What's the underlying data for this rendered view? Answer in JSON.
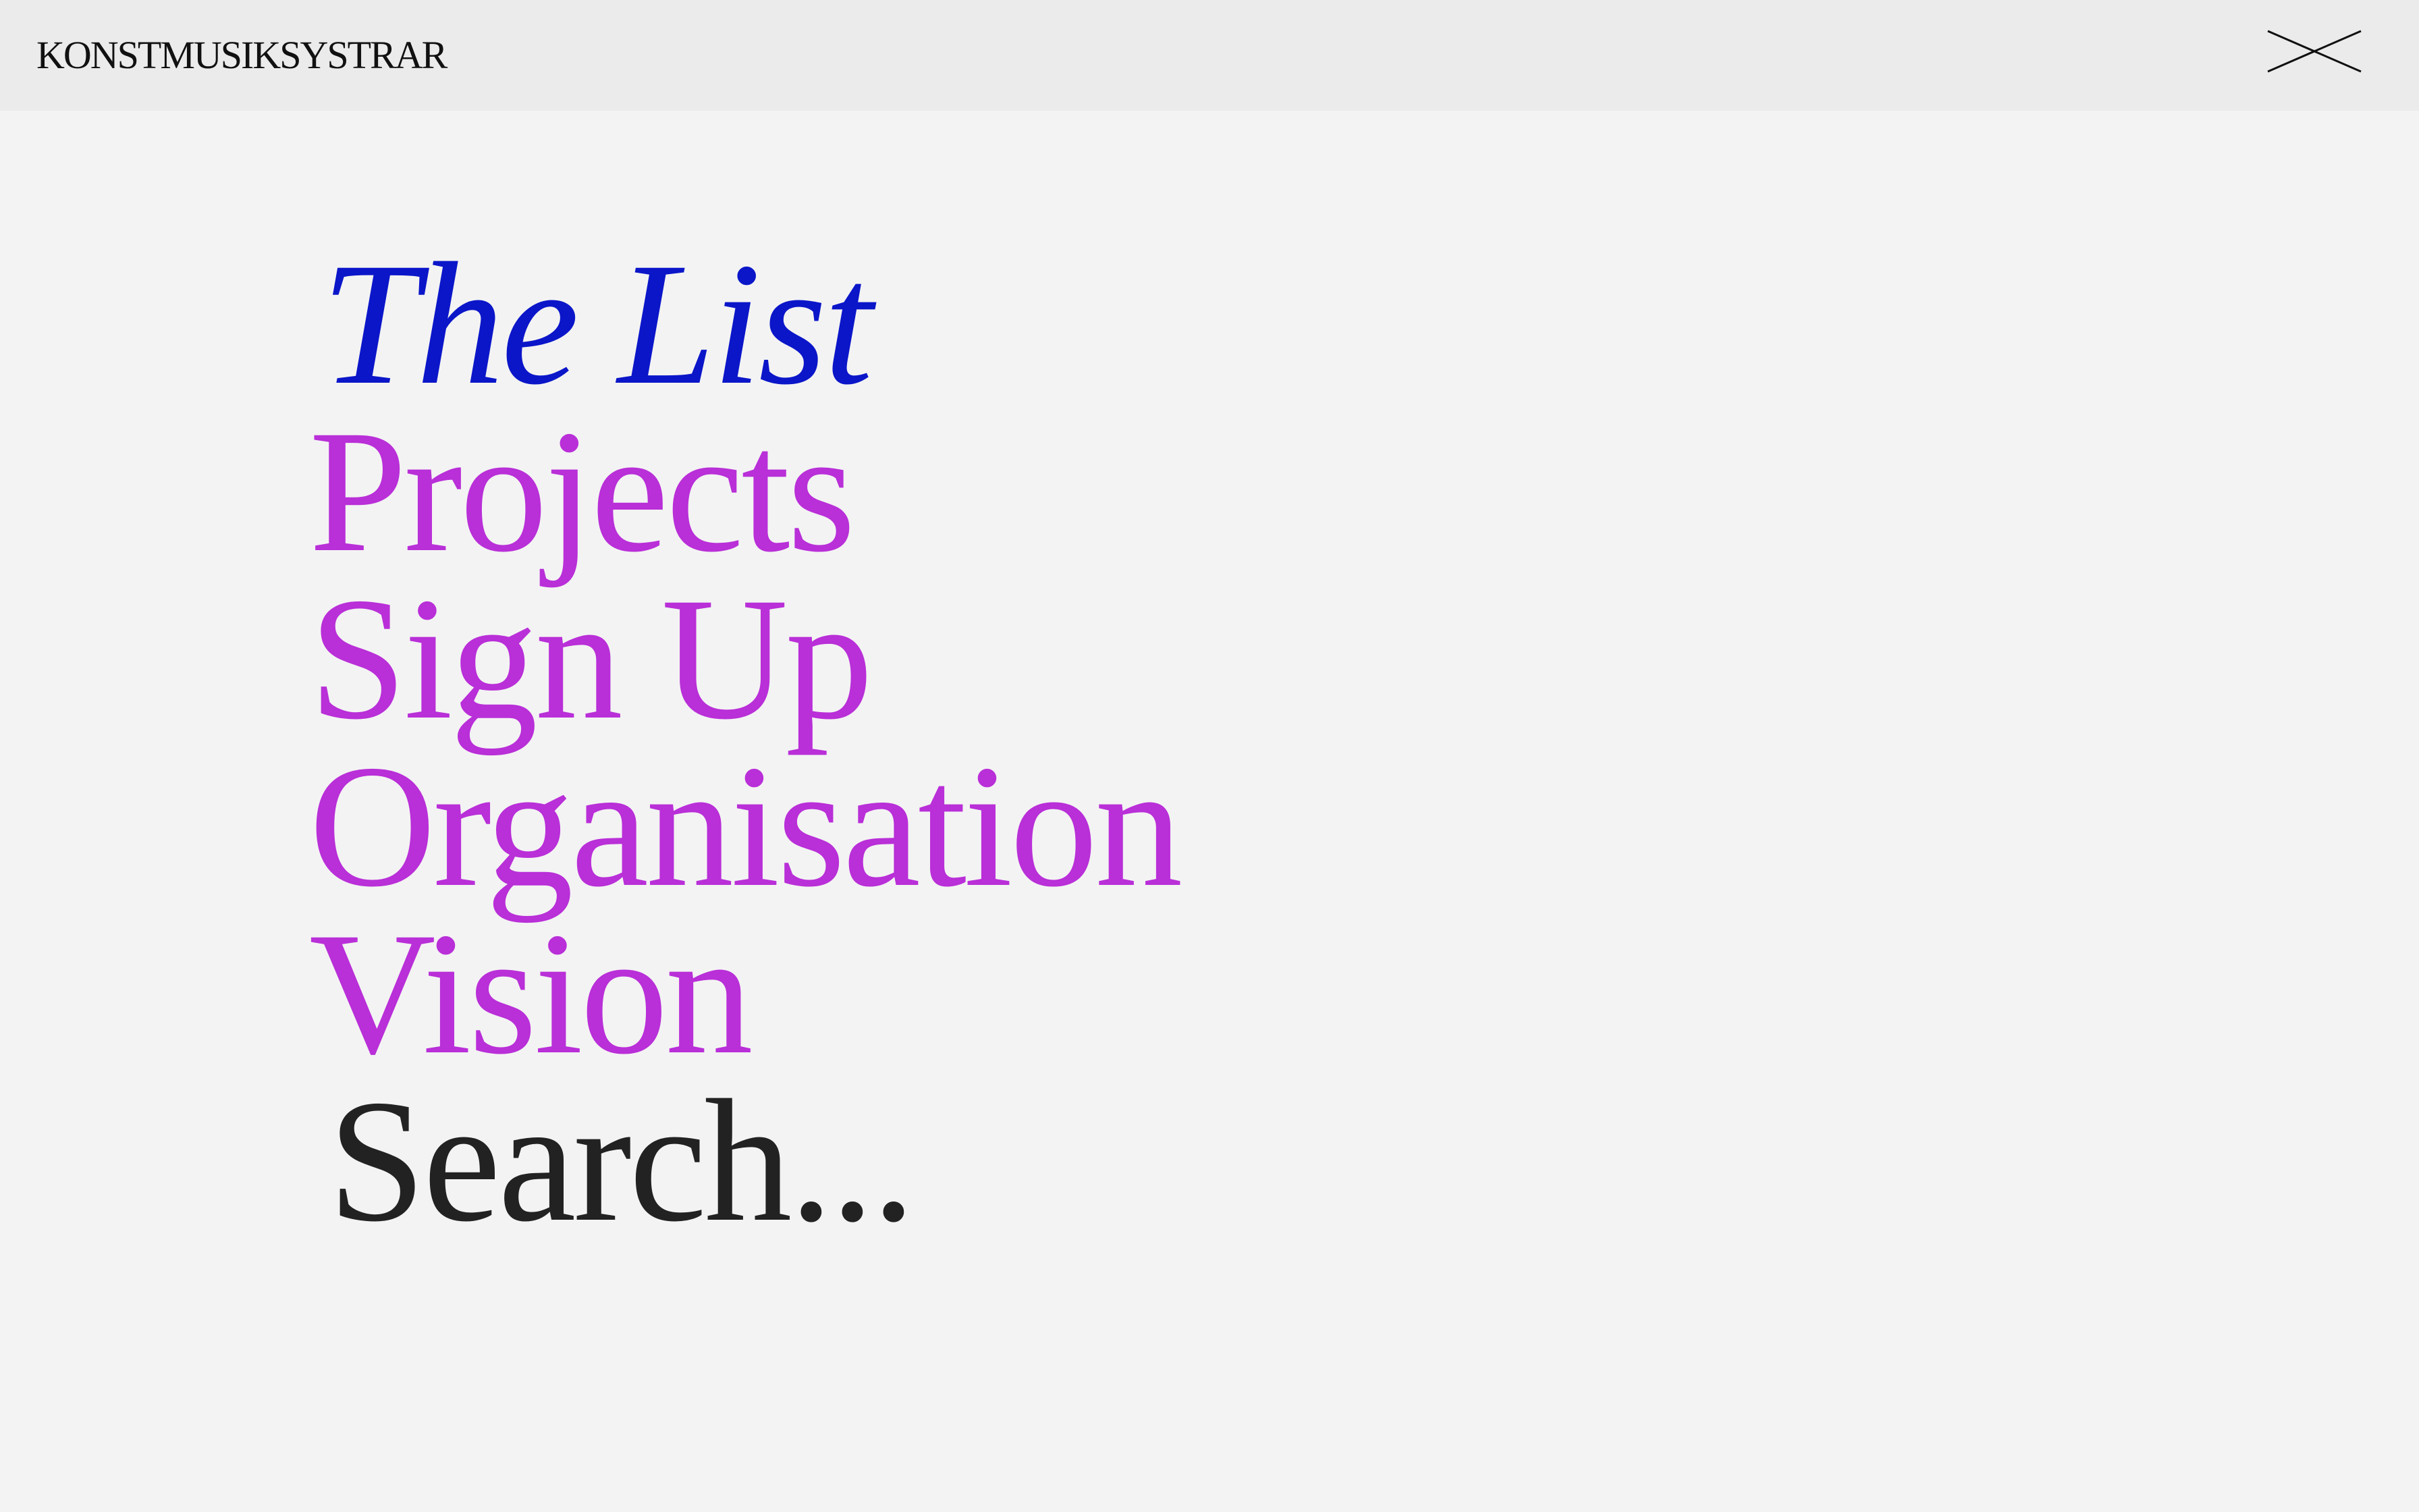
{
  "header": {
    "brand": "KONSTMUSIKSYSTRAR",
    "close_icon": "close-icon"
  },
  "menu": {
    "items": [
      {
        "label": "The List",
        "color": "#0b16c9",
        "style": "italic"
      },
      {
        "label": "Projects",
        "color": "#b92fd8"
      },
      {
        "label": "Sign Up",
        "color": "#b92fd8"
      },
      {
        "label": "Organisation",
        "color": "#b92fd8"
      },
      {
        "label": "Vision",
        "color": "#b92fd8"
      }
    ],
    "search": {
      "label": "Search...",
      "color": "#222222"
    }
  },
  "colors": {
    "background": "#f3f3f3",
    "header_background": "#ebebeb",
    "text_dark": "#111111"
  }
}
